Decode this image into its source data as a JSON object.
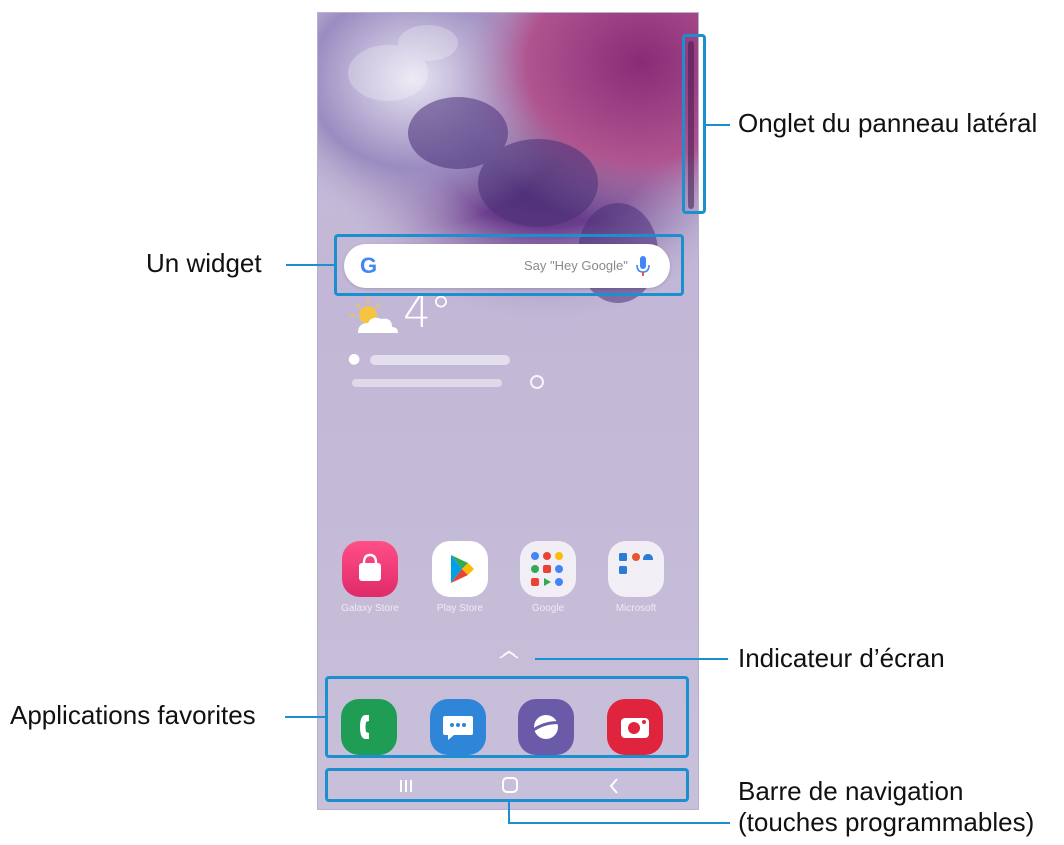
{
  "colors": {
    "callout_line": "#1c8fcf",
    "accent_phone": "#1f9d55",
    "accent_messages": "#2f86d8",
    "accent_internet": "#6a5aa8",
    "accent_camera": "#e0243d"
  },
  "weather": {
    "temperature": "4°",
    "icon": "partly-cloudy-icon"
  },
  "search_widget": {
    "logo": "G",
    "hint": "Say \"Hey Google\"",
    "icon": "mic-icon"
  },
  "apps": [
    {
      "label": "Galaxy Store",
      "icon": "galaxy-store-icon"
    },
    {
      "label": "Play Store",
      "icon": "play-store-icon"
    },
    {
      "label": "Google",
      "icon": "google-folder-icon"
    },
    {
      "label": "Microsoft",
      "icon": "microsoft-folder-icon"
    }
  ],
  "dock": [
    {
      "icon": "phone-icon"
    },
    {
      "icon": "messages-icon"
    },
    {
      "icon": "internet-icon"
    },
    {
      "icon": "camera-icon"
    }
  ],
  "navigation": [
    {
      "icon": "recent-apps-icon"
    },
    {
      "icon": "home-icon"
    },
    {
      "icon": "back-icon"
    }
  ],
  "callouts": {
    "edge_panel": "Onglet du panneau latéral",
    "widget": "Un widget",
    "screen_indicator": "Indicateur d’écran",
    "favorites": "Applications favorites",
    "nav_bar_line1": "Barre de navigation",
    "nav_bar_line2": "(touches programmables)"
  }
}
